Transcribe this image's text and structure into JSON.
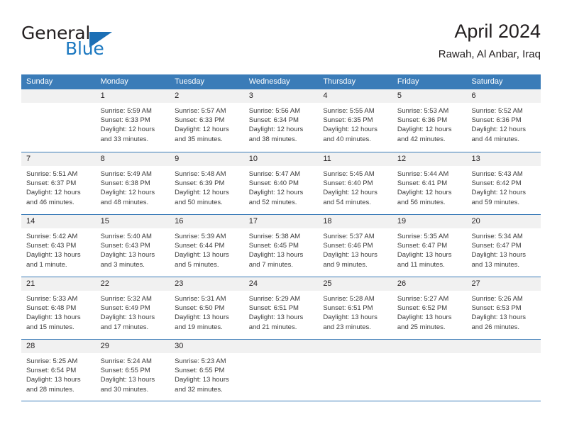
{
  "brand": {
    "name_top": "General",
    "name_bottom": "Blue"
  },
  "header": {
    "title": "April 2024",
    "subtitle": "Rawah, Al Anbar, Iraq"
  },
  "colors": {
    "header_blue": "#3b7cb8",
    "brand_blue": "#1c78c0",
    "day_number_bg": "#f1f1f1",
    "text": "#231f20"
  },
  "weekdays": [
    "Sunday",
    "Monday",
    "Tuesday",
    "Wednesday",
    "Thursday",
    "Friday",
    "Saturday"
  ],
  "weeks": [
    [
      {
        "day": "",
        "lines": []
      },
      {
        "day": "1",
        "lines": [
          "Sunrise: 5:59 AM",
          "Sunset: 6:33 PM",
          "Daylight: 12 hours",
          "and 33 minutes."
        ]
      },
      {
        "day": "2",
        "lines": [
          "Sunrise: 5:57 AM",
          "Sunset: 6:33 PM",
          "Daylight: 12 hours",
          "and 35 minutes."
        ]
      },
      {
        "day": "3",
        "lines": [
          "Sunrise: 5:56 AM",
          "Sunset: 6:34 PM",
          "Daylight: 12 hours",
          "and 38 minutes."
        ]
      },
      {
        "day": "4",
        "lines": [
          "Sunrise: 5:55 AM",
          "Sunset: 6:35 PM",
          "Daylight: 12 hours",
          "and 40 minutes."
        ]
      },
      {
        "day": "5",
        "lines": [
          "Sunrise: 5:53 AM",
          "Sunset: 6:36 PM",
          "Daylight: 12 hours",
          "and 42 minutes."
        ]
      },
      {
        "day": "6",
        "lines": [
          "Sunrise: 5:52 AM",
          "Sunset: 6:36 PM",
          "Daylight: 12 hours",
          "and 44 minutes."
        ]
      }
    ],
    [
      {
        "day": "7",
        "lines": [
          "Sunrise: 5:51 AM",
          "Sunset: 6:37 PM",
          "Daylight: 12 hours",
          "and 46 minutes."
        ]
      },
      {
        "day": "8",
        "lines": [
          "Sunrise: 5:49 AM",
          "Sunset: 6:38 PM",
          "Daylight: 12 hours",
          "and 48 minutes."
        ]
      },
      {
        "day": "9",
        "lines": [
          "Sunrise: 5:48 AM",
          "Sunset: 6:39 PM",
          "Daylight: 12 hours",
          "and 50 minutes."
        ]
      },
      {
        "day": "10",
        "lines": [
          "Sunrise: 5:47 AM",
          "Sunset: 6:40 PM",
          "Daylight: 12 hours",
          "and 52 minutes."
        ]
      },
      {
        "day": "11",
        "lines": [
          "Sunrise: 5:45 AM",
          "Sunset: 6:40 PM",
          "Daylight: 12 hours",
          "and 54 minutes."
        ]
      },
      {
        "day": "12",
        "lines": [
          "Sunrise: 5:44 AM",
          "Sunset: 6:41 PM",
          "Daylight: 12 hours",
          "and 56 minutes."
        ]
      },
      {
        "day": "13",
        "lines": [
          "Sunrise: 5:43 AM",
          "Sunset: 6:42 PM",
          "Daylight: 12 hours",
          "and 59 minutes."
        ]
      }
    ],
    [
      {
        "day": "14",
        "lines": [
          "Sunrise: 5:42 AM",
          "Sunset: 6:43 PM",
          "Daylight: 13 hours",
          "and 1 minute."
        ]
      },
      {
        "day": "15",
        "lines": [
          "Sunrise: 5:40 AM",
          "Sunset: 6:43 PM",
          "Daylight: 13 hours",
          "and 3 minutes."
        ]
      },
      {
        "day": "16",
        "lines": [
          "Sunrise: 5:39 AM",
          "Sunset: 6:44 PM",
          "Daylight: 13 hours",
          "and 5 minutes."
        ]
      },
      {
        "day": "17",
        "lines": [
          "Sunrise: 5:38 AM",
          "Sunset: 6:45 PM",
          "Daylight: 13 hours",
          "and 7 minutes."
        ]
      },
      {
        "day": "18",
        "lines": [
          "Sunrise: 5:37 AM",
          "Sunset: 6:46 PM",
          "Daylight: 13 hours",
          "and 9 minutes."
        ]
      },
      {
        "day": "19",
        "lines": [
          "Sunrise: 5:35 AM",
          "Sunset: 6:47 PM",
          "Daylight: 13 hours",
          "and 11 minutes."
        ]
      },
      {
        "day": "20",
        "lines": [
          "Sunrise: 5:34 AM",
          "Sunset: 6:47 PM",
          "Daylight: 13 hours",
          "and 13 minutes."
        ]
      }
    ],
    [
      {
        "day": "21",
        "lines": [
          "Sunrise: 5:33 AM",
          "Sunset: 6:48 PM",
          "Daylight: 13 hours",
          "and 15 minutes."
        ]
      },
      {
        "day": "22",
        "lines": [
          "Sunrise: 5:32 AM",
          "Sunset: 6:49 PM",
          "Daylight: 13 hours",
          "and 17 minutes."
        ]
      },
      {
        "day": "23",
        "lines": [
          "Sunrise: 5:31 AM",
          "Sunset: 6:50 PM",
          "Daylight: 13 hours",
          "and 19 minutes."
        ]
      },
      {
        "day": "24",
        "lines": [
          "Sunrise: 5:29 AM",
          "Sunset: 6:51 PM",
          "Daylight: 13 hours",
          "and 21 minutes."
        ]
      },
      {
        "day": "25",
        "lines": [
          "Sunrise: 5:28 AM",
          "Sunset: 6:51 PM",
          "Daylight: 13 hours",
          "and 23 minutes."
        ]
      },
      {
        "day": "26",
        "lines": [
          "Sunrise: 5:27 AM",
          "Sunset: 6:52 PM",
          "Daylight: 13 hours",
          "and 25 minutes."
        ]
      },
      {
        "day": "27",
        "lines": [
          "Sunrise: 5:26 AM",
          "Sunset: 6:53 PM",
          "Daylight: 13 hours",
          "and 26 minutes."
        ]
      }
    ],
    [
      {
        "day": "28",
        "lines": [
          "Sunrise: 5:25 AM",
          "Sunset: 6:54 PM",
          "Daylight: 13 hours",
          "and 28 minutes."
        ]
      },
      {
        "day": "29",
        "lines": [
          "Sunrise: 5:24 AM",
          "Sunset: 6:55 PM",
          "Daylight: 13 hours",
          "and 30 minutes."
        ]
      },
      {
        "day": "30",
        "lines": [
          "Sunrise: 5:23 AM",
          "Sunset: 6:55 PM",
          "Daylight: 13 hours",
          "and 32 minutes."
        ]
      },
      {
        "day": "",
        "lines": []
      },
      {
        "day": "",
        "lines": []
      },
      {
        "day": "",
        "lines": []
      },
      {
        "day": "",
        "lines": []
      }
    ]
  ]
}
